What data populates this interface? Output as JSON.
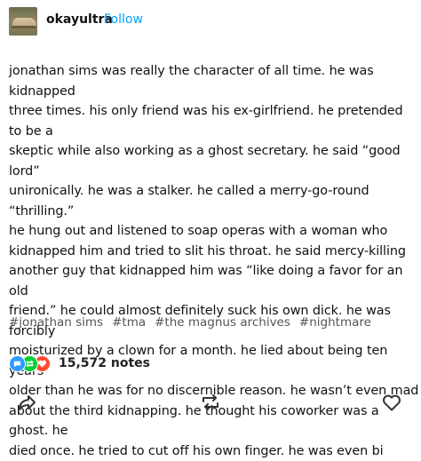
{
  "post": {
    "username": "okayultra",
    "follow_label": "Follow",
    "body": "jonathan sims was really the character of all time. he was kidnapped\nthree times. his only friend was his ex-girlfriend. he pretended to be a\nskeptic while also working as a ghost secretary. he said “good lord”\nunironically. he was a stalker. he called a merry-go-round “thrilling.”\nhe hung out and listened to soap operas with a woman who\nkidnapped him and tried to slit his throat. he said mercy-killing\nanother guy that kidnapped him was “like doing a favor for an old\nfriend.” he could almost definitely suck his own dick. he was forcibly\nmoisturized by a clown for a month. he lied about being ten years\nolder than he was for no discernible reason. he wasn’t even mad\nabout the third kidnapping. he thought his coworker was a ghost. he\ndied once. he tried to cut off his own finger. he was even bi",
    "tags": [
      "#jonathan sims",
      "#tma",
      "#the magnus archives",
      "#nightmare"
    ],
    "notes": "15,572 notes"
  },
  "colors": {
    "follow": "#00a0ff",
    "reply_icon_bg": "#2e9bff",
    "reblog_icon_bg": "#00cf35",
    "like_icon_bg": "#ff4930"
  },
  "icons": {
    "avatar": "shoe-photo",
    "note_types": [
      "reply-icon",
      "reblog-icon",
      "like-icon"
    ],
    "actions": [
      "share-icon",
      "reblog-icon",
      "like-icon"
    ]
  }
}
